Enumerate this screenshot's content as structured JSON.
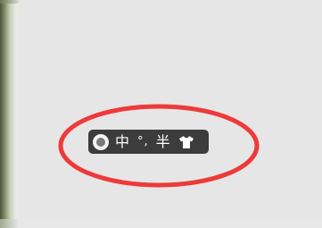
{
  "toolbar": {
    "mode_label": "中",
    "punctuation_label": "°,",
    "width_label": "半"
  },
  "icons": {
    "status": "radio-icon",
    "skin": "tshirt-icon"
  },
  "colors": {
    "background": "#e6e6e6",
    "toolbar": "#3c3c3c",
    "highlight": "#ee3a3a"
  }
}
